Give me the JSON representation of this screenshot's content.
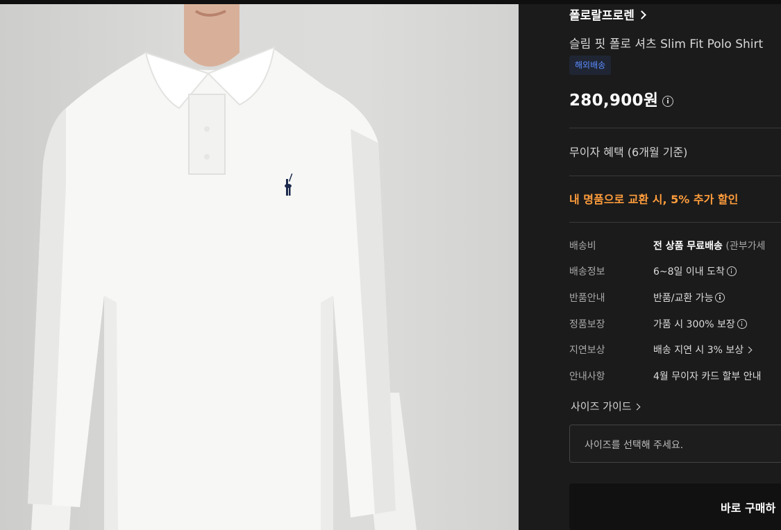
{
  "brand": {
    "name": "폴로랄프로렌"
  },
  "product": {
    "name": "슬림 핏 폴로 셔츠 Slim Fit Polo Shirt",
    "tag": "해외배송",
    "price": "280,900원"
  },
  "benefits": {
    "installment": "무이자 혜택 (6개월 기준)",
    "promo": "내 명품으로 교환 시, 5% 추가 할인"
  },
  "details": [
    {
      "label": "배송비",
      "value_bold": "전 상품 무료배송",
      "value_muted": "(관부가세"
    },
    {
      "label": "배송정보",
      "value": "6~8일 이내 도착"
    },
    {
      "label": "반품안내",
      "value": "반품/교환 가능"
    },
    {
      "label": "정품보장",
      "value": "가품 시 300% 보장"
    },
    {
      "label": "지연보상",
      "value": "배송 지연 시 3% 보상"
    },
    {
      "label": "안내사항",
      "value": "4월 무이자 카드 할부 안내"
    }
  ],
  "size_guide": "사이즈 가이드",
  "size_select": {
    "placeholder": "사이즈를 선택해 주세요."
  },
  "buy_button": "바로 구매하",
  "colors": {
    "background": "#1b1b1b",
    "promo": "#ff9d3c",
    "tag_text": "#5b8cff"
  }
}
